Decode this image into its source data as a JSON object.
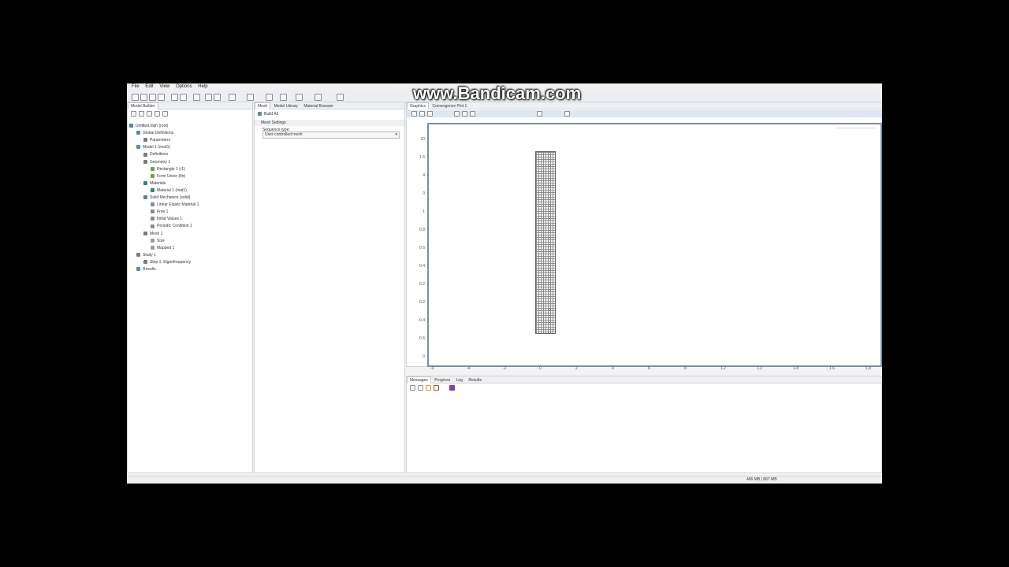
{
  "watermark": "www.Bandicam.com",
  "menu": [
    "File",
    "Edit",
    "View",
    "Options",
    "Help"
  ],
  "model_builder": {
    "title": "Model Builder",
    "items": [
      {
        "label": "Untitled.mph (root)",
        "indent": 0,
        "color": "#5b7bb5"
      },
      {
        "label": "Global Definitions",
        "indent": 1,
        "color": "#4a8fb8"
      },
      {
        "label": "Parameters",
        "indent": 2,
        "color": "#7a7a7a"
      },
      {
        "label": "Model 1 (mod1)",
        "indent": 1,
        "color": "#4a8fb8"
      },
      {
        "label": "Definitions",
        "indent": 2,
        "color": "#7a7a7a"
      },
      {
        "label": "Geometry 1",
        "indent": 2,
        "color": "#7a7a7a"
      },
      {
        "label": "Rectangle 1 (r1)",
        "indent": 3,
        "color": "#7aa04a"
      },
      {
        "label": "Form Union (fin)",
        "indent": 3,
        "color": "#7aa04a"
      },
      {
        "label": "Materials",
        "indent": 2,
        "color": "#2a8a7a"
      },
      {
        "label": "Material 1 (mat1)",
        "indent": 3,
        "color": "#2a8a7a"
      },
      {
        "label": "Solid Mechanics (solid)",
        "indent": 2,
        "color": "#5a7aa8"
      },
      {
        "label": "Linear Elastic Material 1",
        "indent": 3,
        "color": "#8a8a8a"
      },
      {
        "label": "Free 1",
        "indent": 3,
        "color": "#8a8a8a"
      },
      {
        "label": "Initial Values 1",
        "indent": 3,
        "color": "#8a8a8a"
      },
      {
        "label": "Periodic Condition 1",
        "indent": 3,
        "color": "#8a8a8a"
      },
      {
        "label": "Mesh 1",
        "indent": 2,
        "color": "#7a7a7a"
      },
      {
        "label": "Size",
        "indent": 3,
        "color": "#9a9a9a"
      },
      {
        "label": "Mapped 1",
        "indent": 3,
        "color": "#9a9a9a"
      },
      {
        "label": "Study 1",
        "indent": 1,
        "color": "#7a7a7a"
      },
      {
        "label": "Step 1: Eigenfrequency",
        "indent": 2,
        "color": "#7a7a7a"
      },
      {
        "label": "Results",
        "indent": 1,
        "color": "#4a8fb8"
      }
    ]
  },
  "settings": {
    "tabs": [
      "Mesh",
      "Model Library",
      "Material Browser"
    ],
    "build_label": "Build All",
    "section": "Mesh Settings",
    "sequence_label": "Sequence type:",
    "sequence_value": "User-controlled mesh"
  },
  "graphics": {
    "tabs": [
      "Graphics",
      "Convergence Plot 1"
    ],
    "y_ticks": [
      "10",
      "1.6",
      "4",
      "0",
      "1",
      "0.8",
      "0.6",
      "0.4",
      "0.2",
      "-0.2",
      "-0.4",
      "0.6",
      "0"
    ],
    "x_ticks": [
      "-0",
      "-4",
      "-2",
      "0",
      "2",
      "4",
      "6",
      "8",
      "1.2",
      "1.2",
      "1.4",
      "1.6",
      "1.8"
    ]
  },
  "bottom_tabs": [
    "Messages",
    "Progress",
    "Log",
    "Results"
  ],
  "status": "466 MB | 867 MB"
}
